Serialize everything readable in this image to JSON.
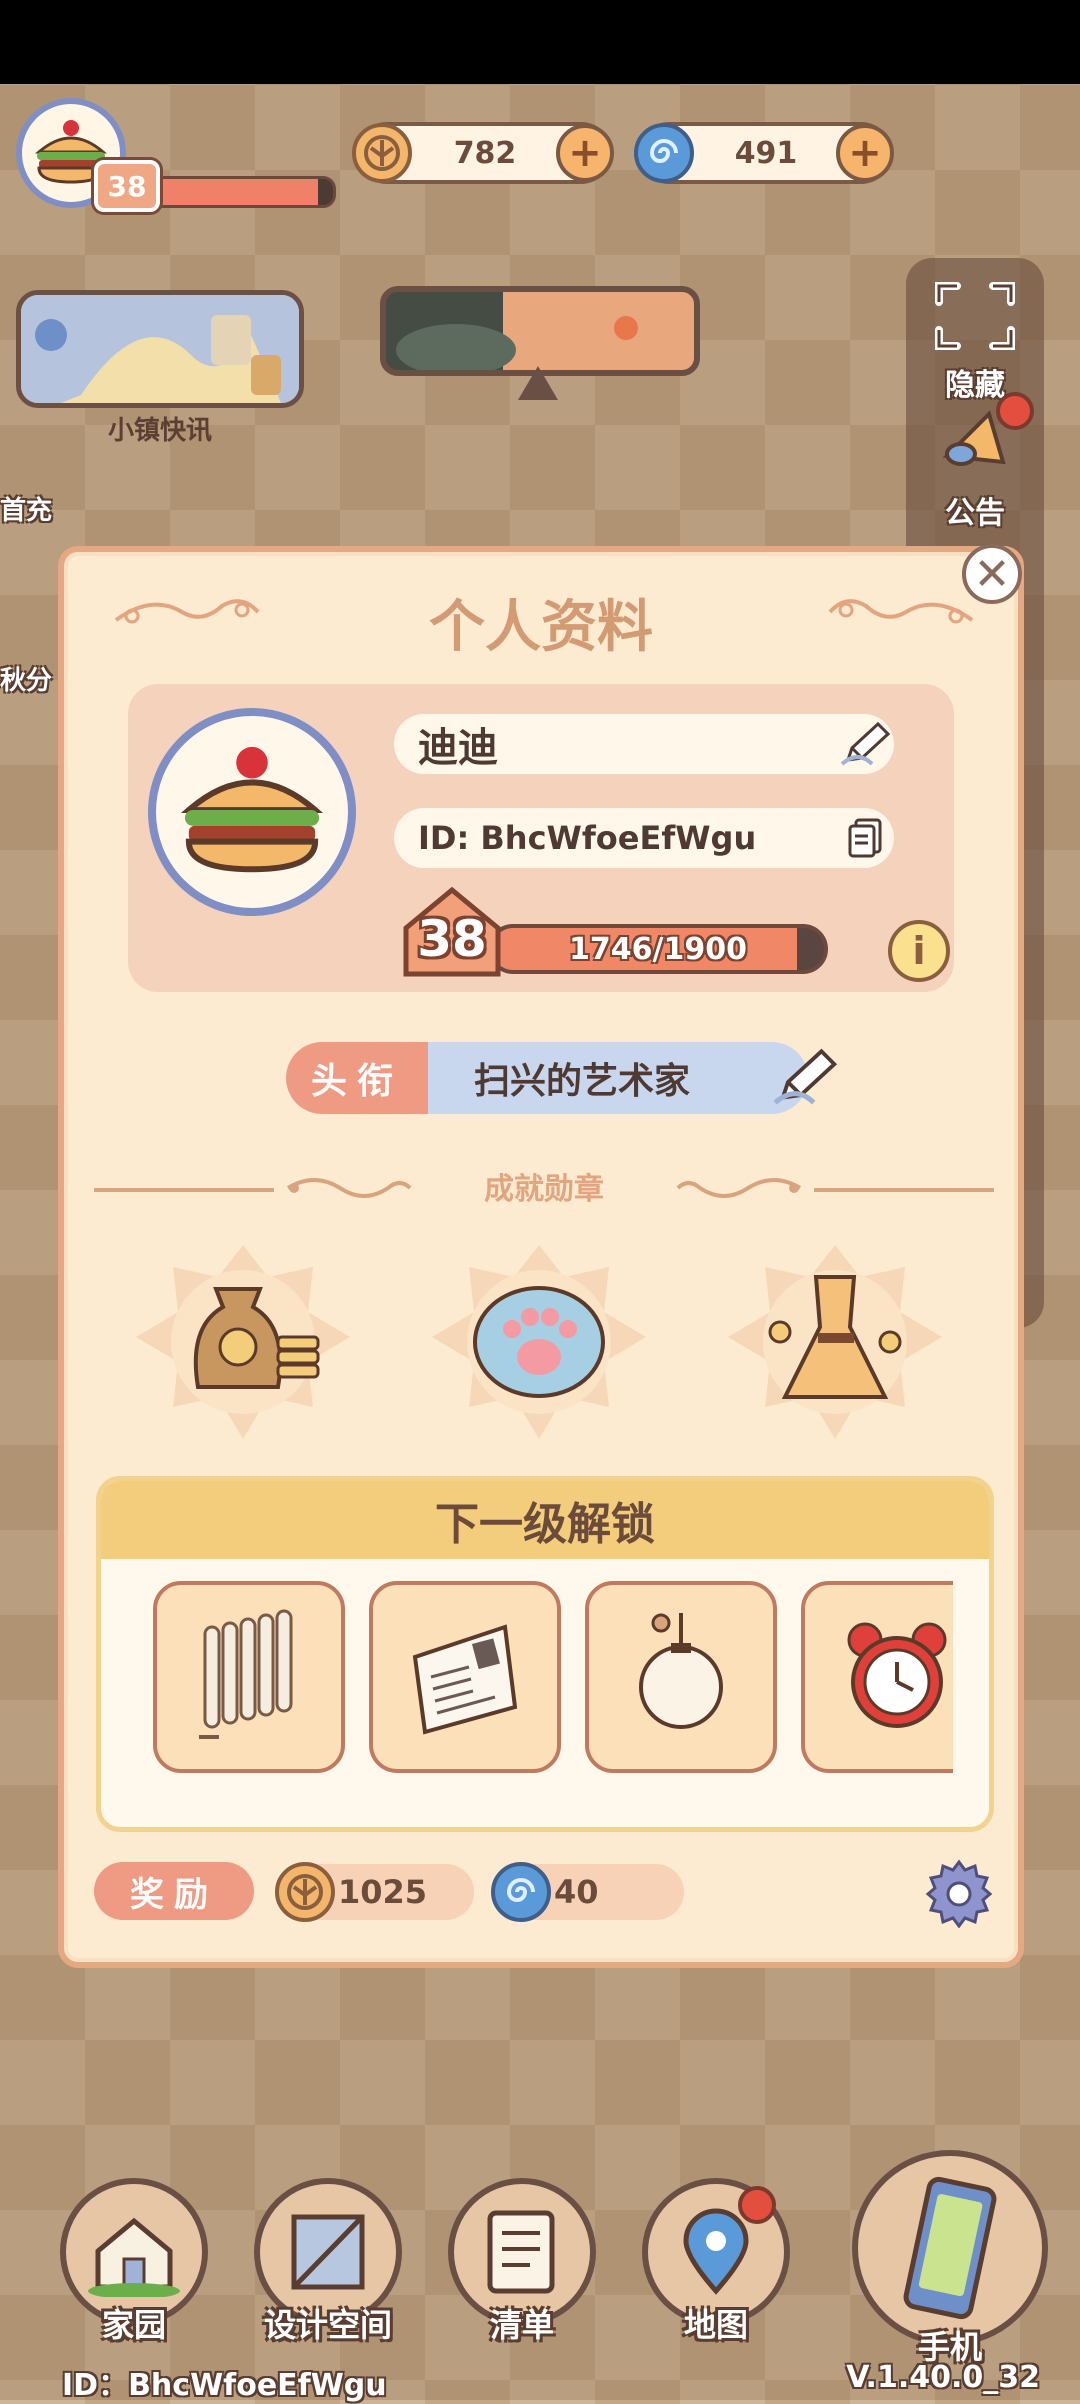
{
  "hud": {
    "level": "38",
    "xp_progress": 0.92,
    "coins": "782",
    "gems": "491",
    "plus": "+"
  },
  "sidebar": {
    "news_label": "小镇快讯",
    "hide_label": "隐藏",
    "announce_label": "公告",
    "left_items": [
      "首充",
      "秋分"
    ]
  },
  "profile": {
    "title": "个人资料",
    "name": "迪迪",
    "id_text": "ID: BhcWfoeEfWgu",
    "level": "38",
    "xp_text": "1746/1900",
    "xp_progress": 0.919,
    "title_tag": "头衔",
    "title_value": "扫兴的艺术家",
    "achievements_label": "成就勋章",
    "next_unlock_label": "下一级解锁",
    "reward_label": "奖励",
    "reward_coins": "1025",
    "reward_gems": "40",
    "info": "i"
  },
  "nav": {
    "items": [
      {
        "label": "家园"
      },
      {
        "label": "设计空间"
      },
      {
        "label": "清单"
      },
      {
        "label": "地图"
      },
      {
        "label": "手机"
      }
    ],
    "bottom_id": "ID：BhcWfoeEfWgu",
    "version": "V.1.40.0_32"
  },
  "icons": {
    "avatar": "burger-icon",
    "coin": "coin-icon",
    "gem": "swirl-gem-icon",
    "close": "close-icon",
    "edit": "pencil-icon",
    "copy": "copy-icon",
    "settings": "gear-icon"
  },
  "colors": {
    "accent": "#ef9a83",
    "modal_bg": "#fcebd1",
    "title_color": "#d39b74",
    "avatar_ring": "#7f8fc6"
  }
}
